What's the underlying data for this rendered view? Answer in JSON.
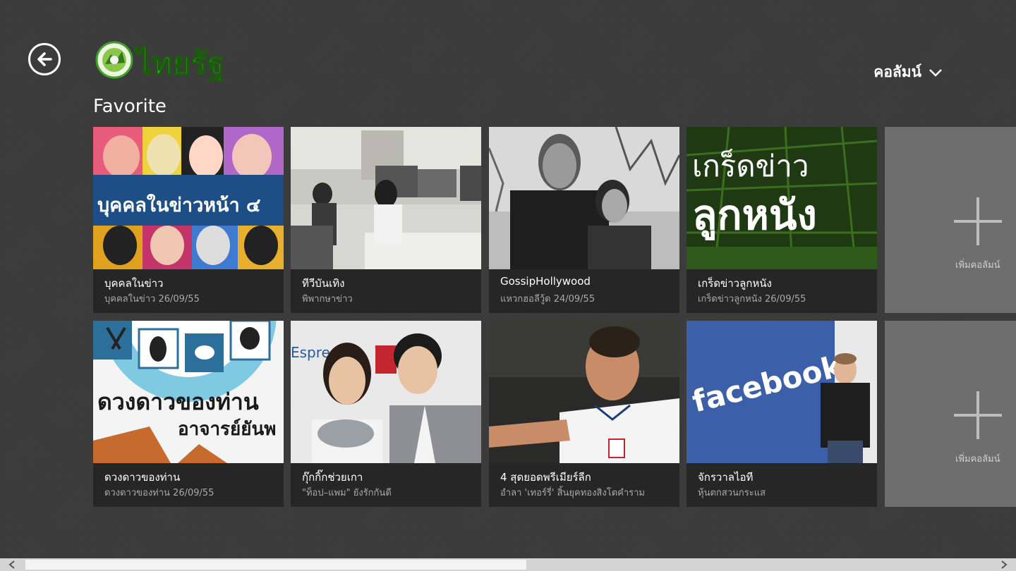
{
  "app": {
    "logo_text": "ไทยรัฐ",
    "page_title": "Favorite",
    "nav_menu_label": "คอลัมน์"
  },
  "tiles": [
    {
      "title": "บุคคลในข่าว",
      "subtitle": "บุคคลในข่าว 26/09/55",
      "image_text": "บุคคลในข่าวหน้า ๔"
    },
    {
      "title": "ทีวีบันเทิง",
      "subtitle": "พิพากษาข่าว"
    },
    {
      "title": "GossipHollywood",
      "subtitle": "แหวกฮอลีวู้ด 24/09/55"
    },
    {
      "title": "เกร็ดข่าวลูกหนัง",
      "subtitle": "เกร็ดข่าวลูกหนัง 26/09/55",
      "image_text_1": "เกร็ดข่าว",
      "image_text_2": "ลูกหนัง"
    },
    {
      "title": "ดวงดาวของท่าน",
      "subtitle": "ดวงดาวของท่าน 26/09/55",
      "image_text_1": "ดวงดาวของท่าน",
      "image_text_2": "อาจารย์ยันพ"
    },
    {
      "title": "กุ๊กกิ๊กช่วยเกา",
      "subtitle": "\"ท็อป–แพม\" ยังรักกันดี",
      "image_text": "Espresso"
    },
    {
      "title": "4 สุดยอดพรีเมียร์ลีก",
      "subtitle": "อำลา 'เทอร์รี่' สิ้นยุคทองสิงโตคำราม"
    },
    {
      "title": "จักรวาลไอที",
      "subtitle": "หุ้นตกสวนกระแส",
      "image_text": "facebook"
    }
  ],
  "add_tiles": [
    {
      "label": "เพิ่มคอลัมน์"
    },
    {
      "label": "เพิ่มคอลัมน์"
    }
  ],
  "colors": {
    "background": "#3b3b3b",
    "tile_background": "#262626",
    "add_tile_background": "#6e6e6e",
    "logo_green": "#3fa02a"
  },
  "icons": {
    "back": "back-arrow-icon",
    "menu": "chevron-down-icon",
    "add": "plus-icon"
  }
}
